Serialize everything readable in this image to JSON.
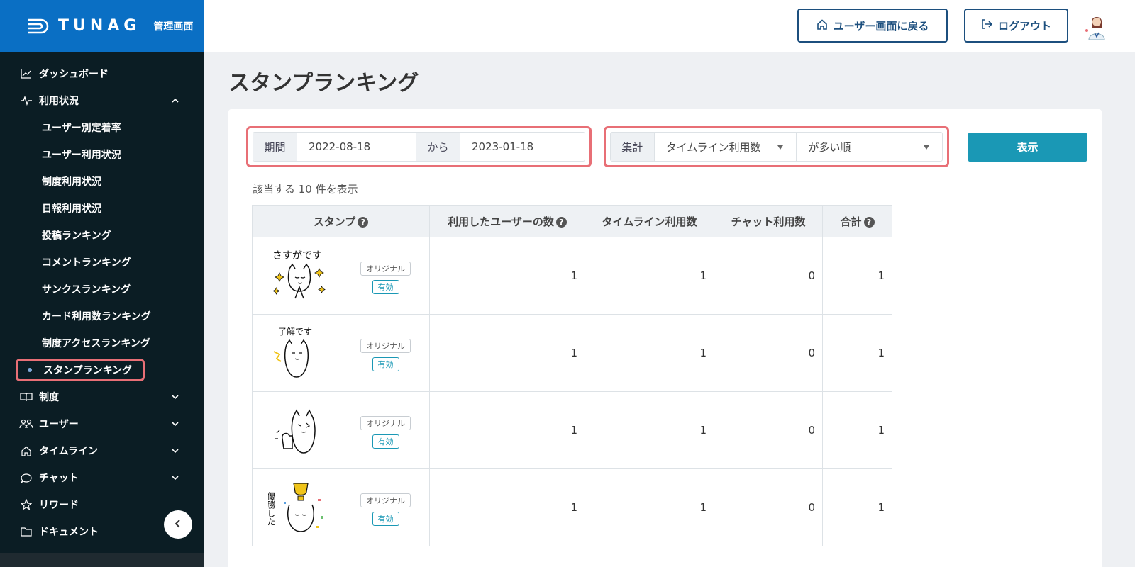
{
  "brand": {
    "name": "TUNAG",
    "subtitle": "管理画面"
  },
  "header": {
    "user_button": "ユーザー画面に戻る",
    "logout_button": "ログアウト"
  },
  "sidebar": {
    "dashboard": "ダッシュボード",
    "usage": "利用状況",
    "usage_items": [
      "ユーザー別定着率",
      "ユーザー利用状況",
      "制度利用状況",
      "日報利用状況",
      "投稿ランキング",
      "コメントランキング",
      "サンクスランキング",
      "カード利用数ランキング",
      "制度アクセスランキング"
    ],
    "active_item": "スタンプランキング",
    "sections": [
      "制度",
      "ユーザー",
      "タイムライン",
      "チャット",
      "リワード",
      "ドキュメント"
    ]
  },
  "page": {
    "title": "スタンプランキング"
  },
  "filters": {
    "period_label": "期間",
    "start_date": "2022-08-18",
    "range_word": "から",
    "end_date": "2023-01-18",
    "agg_label": "集計",
    "metric": "タイムライン利用数",
    "order": "が多い順",
    "show_button": "表示"
  },
  "result": {
    "count_text": "該当する 10 件を表示"
  },
  "table": {
    "headers": [
      "スタンプ",
      "利用したユーザーの数",
      "タイムライン利用数",
      "チャット利用数",
      "合計"
    ],
    "badge_original": "オリジナル",
    "badge_valid": "有効",
    "rows": [
      {
        "stamp": "さすがです",
        "users": "1",
        "timeline": "1",
        "chat": "0",
        "total": "1"
      },
      {
        "stamp": "了解です",
        "users": "1",
        "timeline": "1",
        "chat": "0",
        "total": "1"
      },
      {
        "stamp": "",
        "users": "1",
        "timeline": "1",
        "chat": "0",
        "total": "1"
      },
      {
        "stamp": "優勝した",
        "users": "1",
        "timeline": "1",
        "chat": "0",
        "total": "1"
      }
    ]
  }
}
